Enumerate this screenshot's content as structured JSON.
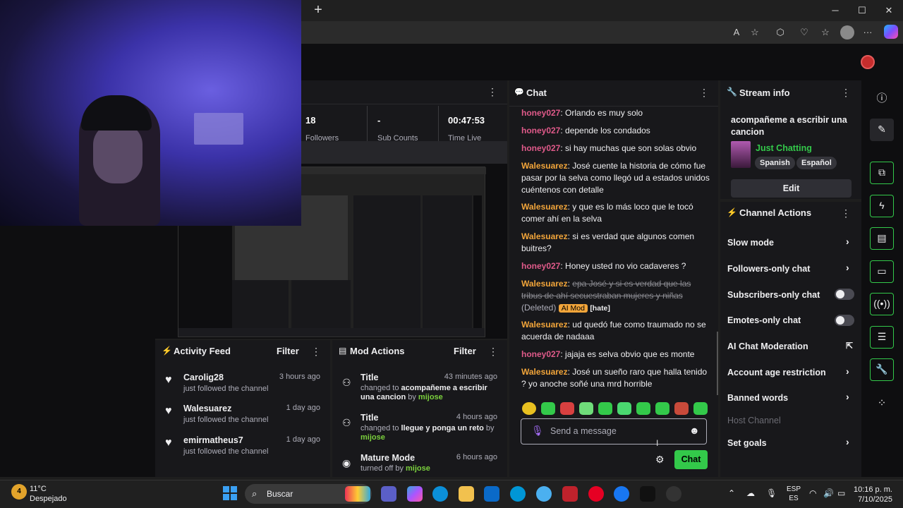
{
  "window": {
    "new_tab": "+",
    "minimize": "─",
    "maximize": "☐",
    "close": "✕"
  },
  "browser": {
    "icons": [
      "read-aloud-icon",
      "favorite-star-icon",
      "extensions-icon",
      "performance-icon",
      "favorites-icon",
      "profile-icon",
      "more-icon",
      "copilot-icon"
    ],
    "glyphs": {
      "read": "A",
      "star": "☆",
      "ext": "⬡",
      "perf": "♡",
      "fav": "☆",
      "more": "···"
    }
  },
  "stats": {
    "followers": "18",
    "followers_label": "Followers",
    "subs": "-",
    "subs_label": "Sub Counts",
    "time": "00:47:53",
    "time_label": "Time Live",
    "menu": "⋮"
  },
  "activity_feed": {
    "title": "Activity Feed",
    "filter": "Filter",
    "menu": "⋮",
    "items": [
      {
        "user": "Carolig28",
        "time": "3 hours ago",
        "desc": "just followed the channel"
      },
      {
        "user": "Walesuarez",
        "time": "1 day ago",
        "desc": "just followed the channel"
      },
      {
        "user": "emirmatheus7",
        "time": "1 day ago",
        "desc": "just followed the channel"
      }
    ]
  },
  "mod_actions": {
    "title": "Mod Actions",
    "filter": "Filter",
    "menu": "⋮",
    "items": [
      {
        "title": "Title",
        "time": "43 minutes ago",
        "pre": "changed to ",
        "value": "acompañeme a escribir una cancion",
        "by_word": " by ",
        "by": "mijose"
      },
      {
        "title": "Title",
        "time": "4 hours ago",
        "pre": "changed to ",
        "value": "llegue y ponga un reto",
        "by_word": " by ",
        "by": "mijose"
      },
      {
        "title": "Mature Mode",
        "time": "6 hours ago",
        "pre": "turned off by ",
        "value": "",
        "by_word": "",
        "by": "mijose"
      }
    ]
  },
  "chat": {
    "title": "Chat",
    "menu": "⋮",
    "messages": [
      {
        "user": "honey027",
        "text": "Orlando es muy solo"
      },
      {
        "user": "honey027",
        "text": "depende los condados"
      },
      {
        "user": "honey027",
        "text": "si hay muchas que son solas obvio"
      },
      {
        "user": "Walesuarez",
        "text": "José cuente la historia de cómo fue pasar por la selva como llegó ud a estados unidos cuéntenos con detalle"
      },
      {
        "user": "Walesuarez",
        "text": "y que es lo más loco que le tocó comer ahí en la selva"
      },
      {
        "user": "Walesuarez",
        "text": "si es verdad que algunos comen buitres?"
      },
      {
        "user": "honey027",
        "text": "Honey usted no vio cadaveres ?"
      },
      {
        "user": "Walesuarez",
        "text": "epa José y si es verdad que las tribus de ahí secuestraban mujeres y niñas",
        "deleted_tag": "(Deleted)",
        "ai_badge": "AI Mod",
        "reason": "[hate]"
      },
      {
        "user": "Walesuarez",
        "text": "ud quedó fue como traumado no se acuerda de nadaaa"
      },
      {
        "user": "honey027",
        "text": "jajaja es selva obvio que es monte"
      },
      {
        "user": "Walesuarez",
        "text": "José un sueño raro que halla tenido ? yo anoche soñé una mrd horrible"
      }
    ],
    "placeholder": "Send a message",
    "send_label": "Chat",
    "colon": ": "
  },
  "stream_info": {
    "title": "Stream info",
    "menu": "⋮",
    "stream_title": "acompañeme a escribir una cancion",
    "category": "Just Chatting",
    "tags": [
      "Spanish",
      "Español"
    ],
    "edit_label": "Edit"
  },
  "channel_actions": {
    "title": "Channel Actions",
    "menu": "⋮",
    "rows": [
      {
        "label": "Slow mode",
        "control": "chevron"
      },
      {
        "label": "Followers-only chat",
        "control": "chevron"
      },
      {
        "label": "Subscribers-only chat",
        "control": "toggle",
        "state": "off"
      },
      {
        "label": "Emotes-only chat",
        "control": "toggle",
        "state": "off"
      },
      {
        "label": "AI Chat Moderation",
        "control": "external"
      },
      {
        "label": "Account age restriction",
        "control": "chevron"
      },
      {
        "label": "Banned words",
        "control": "chevron"
      },
      {
        "label": "Host Channel",
        "control": "disabled"
      },
      {
        "label": "Set goals",
        "control": "chevron"
      }
    ],
    "chevron": "›",
    "external": "⇱"
  },
  "taskbar": {
    "temp": "11°C",
    "weather": "Despejado",
    "weather_badge": "4",
    "search": "Buscar",
    "lang1": "ESP",
    "lang2": "ES",
    "time": "10:16 p. m.",
    "date": "7/10/2025"
  },
  "colors": {
    "accent": "#33c94a",
    "honey": "#e05a8a",
    "wale": "#f2a53a",
    "panel": "#18181b"
  }
}
